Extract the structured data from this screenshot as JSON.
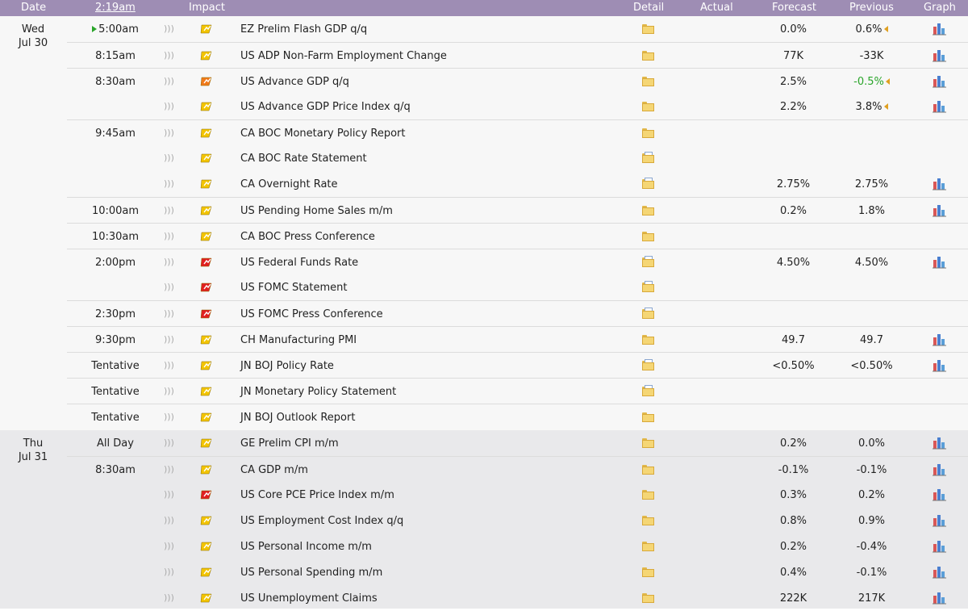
{
  "header": {
    "date": "Date",
    "time": "2:19am",
    "impact": "Impact",
    "detail": "Detail",
    "actual": "Actual",
    "forecast": "Forecast",
    "previous": "Previous",
    "graph": "Graph"
  },
  "colors": {
    "header_bg": "#9e8db4",
    "impact_low": "#f2c400",
    "impact_medium": "#f07a1a",
    "impact_high": "#e02020",
    "positive": "#2aa52a",
    "revised_marker": "#e0a020"
  },
  "icons": {
    "sound": "sound-icon",
    "impact": "impact-folder-icon",
    "detail": "detail-folder-icon",
    "graph": "bar-chart-icon"
  },
  "days": [
    {
      "day": "Wed",
      "date": "Jul 30",
      "events": [
        {
          "time": "5:00am",
          "live": true,
          "impact": "low",
          "event": "EZ Prelim Flash GDP q/q",
          "detail": "folder",
          "actual": "",
          "forecast": "0.0%",
          "previous": "0.6%",
          "revised": true,
          "graph": true,
          "sep": true
        },
        {
          "time": "8:15am",
          "impact": "low",
          "event": "US ADP Non-Farm Employment Change",
          "detail": "folder",
          "actual": "",
          "forecast": "77K",
          "previous": "-33K",
          "graph": true,
          "sep": true
        },
        {
          "time": "8:30am",
          "impact": "medium",
          "event": "US Advance GDP q/q",
          "detail": "folder",
          "actual": "",
          "forecast": "2.5%",
          "previous": "-0.5%",
          "prev_positive": true,
          "revised": true,
          "graph": true,
          "sep": true
        },
        {
          "time": "",
          "impact": "low",
          "event": "US Advance GDP Price Index q/q",
          "detail": "folder",
          "actual": "",
          "forecast": "2.2%",
          "previous": "3.8%",
          "revised": true,
          "graph": true,
          "sep": false
        },
        {
          "time": "9:45am",
          "impact": "low",
          "event": "CA BOC Monetary Policy Report",
          "detail": "folder",
          "actual": "",
          "forecast": "",
          "previous": "",
          "graph": false,
          "sep": true
        },
        {
          "time": "",
          "impact": "low",
          "event": "CA BOC Rate Statement",
          "detail": "doc",
          "actual": "",
          "forecast": "",
          "previous": "",
          "graph": false,
          "sep": false
        },
        {
          "time": "",
          "impact": "low",
          "event": "CA Overnight Rate",
          "detail": "doc",
          "actual": "",
          "forecast": "2.75%",
          "previous": "2.75%",
          "graph": true,
          "sep": false
        },
        {
          "time": "10:00am",
          "impact": "low",
          "event": "US Pending Home Sales m/m",
          "detail": "folder",
          "actual": "",
          "forecast": "0.2%",
          "previous": "1.8%",
          "graph": true,
          "sep": true
        },
        {
          "time": "10:30am",
          "impact": "low",
          "event": "CA BOC Press Conference",
          "detail": "folder",
          "actual": "",
          "forecast": "",
          "previous": "",
          "graph": false,
          "sep": true
        },
        {
          "time": "2:00pm",
          "impact": "high",
          "event": "US Federal Funds Rate",
          "detail": "doc",
          "actual": "",
          "forecast": "4.50%",
          "previous": "4.50%",
          "graph": true,
          "sep": true
        },
        {
          "time": "",
          "impact": "high",
          "event": "US FOMC Statement",
          "detail": "doc",
          "actual": "",
          "forecast": "",
          "previous": "",
          "graph": false,
          "sep": false
        },
        {
          "time": "2:30pm",
          "impact": "high",
          "event": "US FOMC Press Conference",
          "detail": "doc",
          "actual": "",
          "forecast": "",
          "previous": "",
          "graph": false,
          "sep": true
        },
        {
          "time": "9:30pm",
          "impact": "low",
          "event": "CH Manufacturing PMI",
          "detail": "folder",
          "actual": "",
          "forecast": "49.7",
          "previous": "49.7",
          "graph": true,
          "sep": true
        },
        {
          "time": "Tentative",
          "impact": "low",
          "event": "JN BOJ Policy Rate",
          "detail": "doc",
          "actual": "",
          "forecast": "<0.50%",
          "previous": "<0.50%",
          "graph": true,
          "sep": true
        },
        {
          "time": "Tentative",
          "impact": "low",
          "event": "JN Monetary Policy Statement",
          "detail": "doc",
          "actual": "",
          "forecast": "",
          "previous": "",
          "graph": false,
          "sep": true
        },
        {
          "time": "Tentative",
          "impact": "low",
          "event": "JN BOJ Outlook Report",
          "detail": "folder",
          "actual": "",
          "forecast": "",
          "previous": "",
          "graph": false,
          "sep": true
        }
      ]
    },
    {
      "day": "Thu",
      "date": "Jul 31",
      "events": [
        {
          "time": "All Day",
          "impact": "low",
          "event": "GE Prelim CPI m/m",
          "detail": "folder",
          "actual": "",
          "forecast": "0.2%",
          "previous": "0.0%",
          "graph": true,
          "sep": false
        },
        {
          "time": "8:30am",
          "impact": "low",
          "event": "CA GDP m/m",
          "detail": "folder",
          "actual": "",
          "forecast": "-0.1%",
          "previous": "-0.1%",
          "graph": true,
          "sep": true
        },
        {
          "time": "",
          "impact": "high",
          "event": "US Core PCE Price Index m/m",
          "detail": "folder",
          "actual": "",
          "forecast": "0.3%",
          "previous": "0.2%",
          "graph": true,
          "sep": false
        },
        {
          "time": "",
          "impact": "low",
          "event": "US Employment Cost Index q/q",
          "detail": "folder",
          "actual": "",
          "forecast": "0.8%",
          "previous": "0.9%",
          "graph": true,
          "sep": false
        },
        {
          "time": "",
          "impact": "low",
          "event": "US Personal Income m/m",
          "detail": "folder",
          "actual": "",
          "forecast": "0.2%",
          "previous": "-0.4%",
          "graph": true,
          "sep": false
        },
        {
          "time": "",
          "impact": "low",
          "event": "US Personal Spending m/m",
          "detail": "folder",
          "actual": "",
          "forecast": "0.4%",
          "previous": "-0.1%",
          "graph": true,
          "sep": false
        },
        {
          "time": "",
          "impact": "low",
          "event": "US Unemployment Claims",
          "detail": "folder",
          "actual": "",
          "forecast": "222K",
          "previous": "217K",
          "graph": true,
          "sep": false
        }
      ]
    }
  ]
}
